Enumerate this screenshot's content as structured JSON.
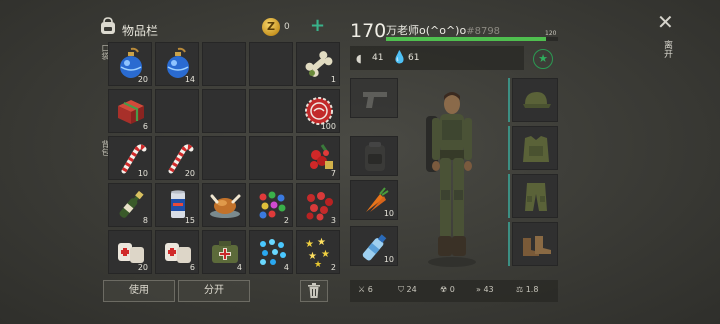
{
  "inventory": {
    "title": "物品栏",
    "currency": {
      "amount": "0",
      "symbol": "Z",
      "add_symbol": "+"
    },
    "pocket_label": "口袋",
    "backpack_label": "背包",
    "pocket_slots": [
      {
        "item": "blue-ornament-icon",
        "qty": "20"
      },
      {
        "item": "blue-ornament-icon",
        "qty": "14"
      },
      {
        "item": "",
        "qty": ""
      },
      {
        "item": "",
        "qty": ""
      },
      {
        "item": "bone-icon",
        "qty": "1"
      },
      {
        "item": "gift-box-icon",
        "qty": "6"
      },
      {
        "item": "",
        "qty": ""
      },
      {
        "item": "",
        "qty": ""
      },
      {
        "item": "",
        "qty": ""
      },
      {
        "item": "bottle-cap-icon",
        "qty": "100"
      }
    ],
    "backpack_slots": [
      {
        "item": "candy-cane-icon",
        "qty": "10"
      },
      {
        "item": "candy-cane-icon",
        "qty": "20"
      },
      {
        "item": "",
        "qty": ""
      },
      {
        "item": "",
        "qty": ""
      },
      {
        "item": "red-berries-icon",
        "qty": "7"
      },
      {
        "item": "champagne-bottle-icon",
        "qty": "8"
      },
      {
        "item": "soda-can-icon",
        "qty": "15"
      },
      {
        "item": "roast-turkey-icon",
        "qty": ""
      },
      {
        "item": "colorful-ornaments-icon",
        "qty": "2"
      },
      {
        "item": "red-ornaments-icon",
        "qty": "3"
      },
      {
        "item": "medical-bandage-icon",
        "qty": "20"
      },
      {
        "item": "medical-bandage-icon",
        "qty": "6"
      },
      {
        "item": "medkit-bag-icon",
        "qty": "4"
      },
      {
        "item": "blue-lights-icon",
        "qty": "4"
      },
      {
        "item": "gold-stars-icon",
        "qty": "2"
      }
    ],
    "use_label": "使用",
    "split_label": "分开"
  },
  "character": {
    "level": "170",
    "name": "万老师o(^o^)o",
    "player_id": "#8798",
    "xp_max": "120",
    "xp_fraction": 0.93,
    "hunger": "41",
    "thirst": "61",
    "weapon_slot_qty": "",
    "food_slot_qty": "10",
    "drink_slot_qty": "10",
    "stats": {
      "attack": "6",
      "defense": "24",
      "radiation": "0",
      "speed": "43",
      "weight": "1.8"
    }
  },
  "close_label": "离开",
  "colors": {
    "accent_green": "#4fbf4f",
    "teal": "#39b38b",
    "slot_bg": "#303030"
  }
}
